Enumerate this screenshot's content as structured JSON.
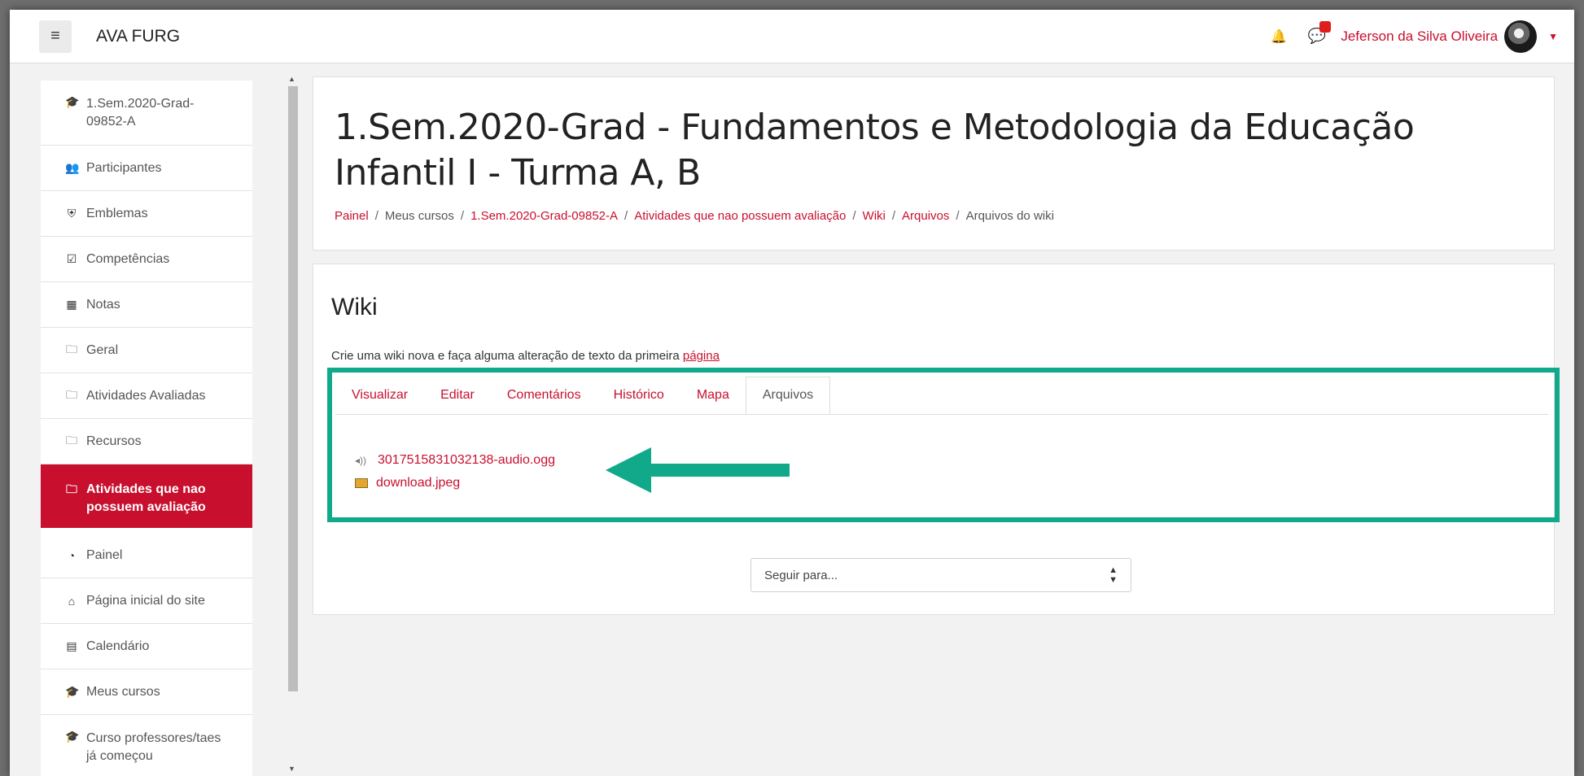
{
  "navbar": {
    "menu_icon": "hamburger-icon",
    "brand": "AVA FURG",
    "notifications_icon": "bell-icon",
    "messages_icon": "chat-icon",
    "user_name": "Jeferson da Silva Oliveira",
    "accent_color": "#c8102e"
  },
  "sidebar": {
    "items": [
      {
        "label": "1.Sem.2020-Grad-09852-A",
        "icon": "graduation-cap-icon"
      },
      {
        "label": "Participantes",
        "icon": "users-icon"
      },
      {
        "label": "Emblemas",
        "icon": "shield-icon"
      },
      {
        "label": "Competências",
        "icon": "checkbox-icon"
      },
      {
        "label": "Notas",
        "icon": "table-icon"
      },
      {
        "label": "Geral",
        "icon": "folder-icon"
      },
      {
        "label": "Atividades Avaliadas",
        "icon": "folder-icon"
      },
      {
        "label": "Recursos",
        "icon": "folder-icon"
      },
      {
        "label": "Atividades que nao possuem avaliação",
        "icon": "folder-icon",
        "active": true
      },
      {
        "label": "Painel",
        "icon": "dashboard-icon"
      },
      {
        "label": "Página inicial do site",
        "icon": "home-icon"
      },
      {
        "label": "Calendário",
        "icon": "calendar-icon"
      },
      {
        "label": "Meus cursos",
        "icon": "graduation-cap-icon"
      },
      {
        "label": "Curso professores/taes já começou",
        "icon": "graduation-cap-icon"
      }
    ]
  },
  "header": {
    "course_title": "1.Sem.2020-Grad - Fundamentos e Metodologia da Educação Infantil I - Turma A, B",
    "breadcrumb": [
      "Painel",
      "Meus cursos",
      "1.Sem.2020-Grad-09852-A",
      "Atividades que nao possuem avaliação",
      "Wiki",
      "Arquivos",
      "Arquivos do wiki"
    ]
  },
  "wiki": {
    "title": "Wiki",
    "description": "Crie uma wiki nova e faça alguma alteração de texto da primeira",
    "description_link": "página",
    "tabs": [
      "Visualizar",
      "Editar",
      "Comentários",
      "Histórico",
      "Mapa",
      "Arquivos"
    ],
    "active_tab": "Arquivos",
    "files": [
      {
        "name": "3017515831032138-audio.ogg",
        "icon": "audio-file-icon"
      },
      {
        "name": "download.jpeg",
        "icon": "image-file-icon"
      }
    ],
    "highlight_color": "#10a98a"
  },
  "jump": {
    "placeholder": "Seguir para..."
  }
}
